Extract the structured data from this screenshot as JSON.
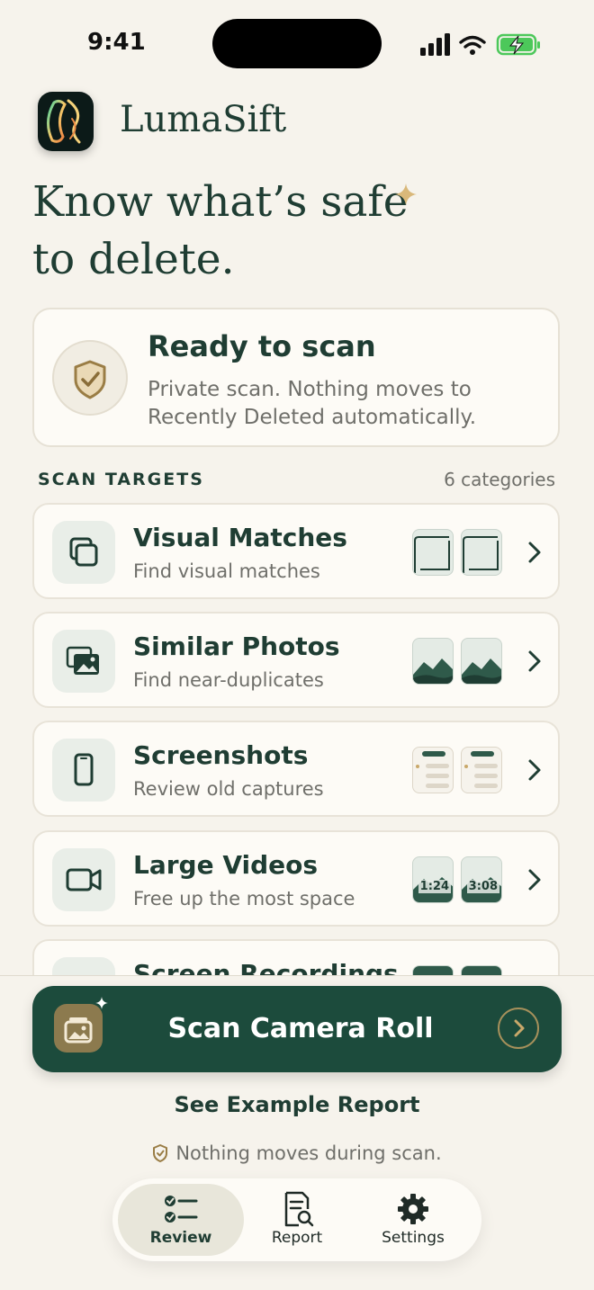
{
  "status_bar": {
    "time": "9:41"
  },
  "brand": {
    "name": "LumaSift",
    "icon": "app-logo-icon"
  },
  "headline": {
    "line1": "Know what’s safe",
    "line2": "to delete."
  },
  "ready": {
    "title": "Ready to scan",
    "subtitle": "Private scan. Nothing moves to Recently Deleted automatically.",
    "icon": "shield-check-icon"
  },
  "scan_targets": {
    "title": "SCAN TARGETS",
    "count": "6 categories",
    "items": [
      {
        "title": "Visual Matches",
        "subtitle": "Find visual matches",
        "icon": "copy-icon"
      },
      {
        "title": "Similar Photos",
        "subtitle": "Find near-duplicates",
        "icon": "photos-icon"
      },
      {
        "title": "Screenshots",
        "subtitle": "Review old captures",
        "icon": "phone-icon"
      },
      {
        "title": "Large Videos",
        "subtitle": "Free up the most space",
        "icon": "video-camera-icon",
        "durations": [
          "1:24",
          "3:08"
        ]
      },
      {
        "title": "Screen Recordings",
        "subtitle": "",
        "icon": "record-icon"
      }
    ]
  },
  "cta": {
    "label": "Scan Camera Roll",
    "icon": "photo-stack-icon"
  },
  "example_link": "See Example Report",
  "note": "Nothing moves during scan.",
  "tabs": [
    {
      "label": "Review",
      "icon": "checklist-icon",
      "active": true
    },
    {
      "label": "Report",
      "icon": "report-search-icon",
      "active": false
    },
    {
      "label": "Settings",
      "icon": "gear-icon",
      "active": false
    }
  ],
  "colors": {
    "background": "#f6f3ec",
    "primary": "#1c4b3c",
    "accent": "#c9a86a",
    "text": "#1f3d33"
  }
}
